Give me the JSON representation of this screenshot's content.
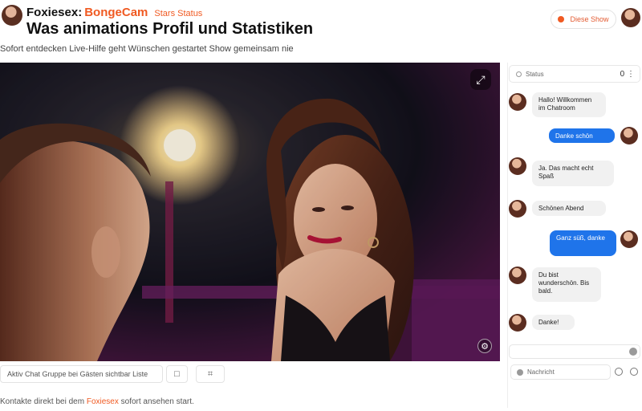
{
  "header": {
    "brand_name": "Foxiesex:",
    "brand_accent": "BongeCam",
    "brand_sub": "Stars Status",
    "title": "Was animations Profil und Statistiken",
    "subtitle": "Sofort entdecken Live-Hilfe geht Wünschen gestartet Show gemeinsam nie",
    "top_action_label": "Diese Show"
  },
  "video": {
    "fullscreen_icon": "fullscreen-icon",
    "settings_icon": "settings-icon"
  },
  "controls": {
    "text_label": "Aktiv Chat Gruppe bei Gästen sichtbar Liste",
    "button_1_label": "□",
    "button_2_label": "⌗"
  },
  "bottom_note": {
    "prefix": "Kontakte direkt bei dem ",
    "accent": "Foxiesex",
    "suffix": " sofort ansehen start."
  },
  "chat": {
    "header_label": "Status",
    "header_icons": "0 ⋮",
    "messages": [
      {
        "side": "in",
        "text": "Hallo! Willkommen im Chatroom"
      },
      {
        "side": "out",
        "text": "Danke schön"
      },
      {
        "side": "in",
        "text": "Ja. Das macht echt Spaß"
      },
      {
        "side": "in",
        "text": "Schönen Abend"
      },
      {
        "side": "out",
        "text": "Ganz süß, danke"
      },
      {
        "side": "in",
        "text": "Du bist wunderschön. Bis bald."
      },
      {
        "side": "in",
        "text": "Danke!"
      }
    ],
    "input2_label": "Nachricht"
  },
  "colors": {
    "accent": "#f05a22",
    "chat_blue": "#1f74ea",
    "bubble_gray": "#f1f1f1"
  }
}
